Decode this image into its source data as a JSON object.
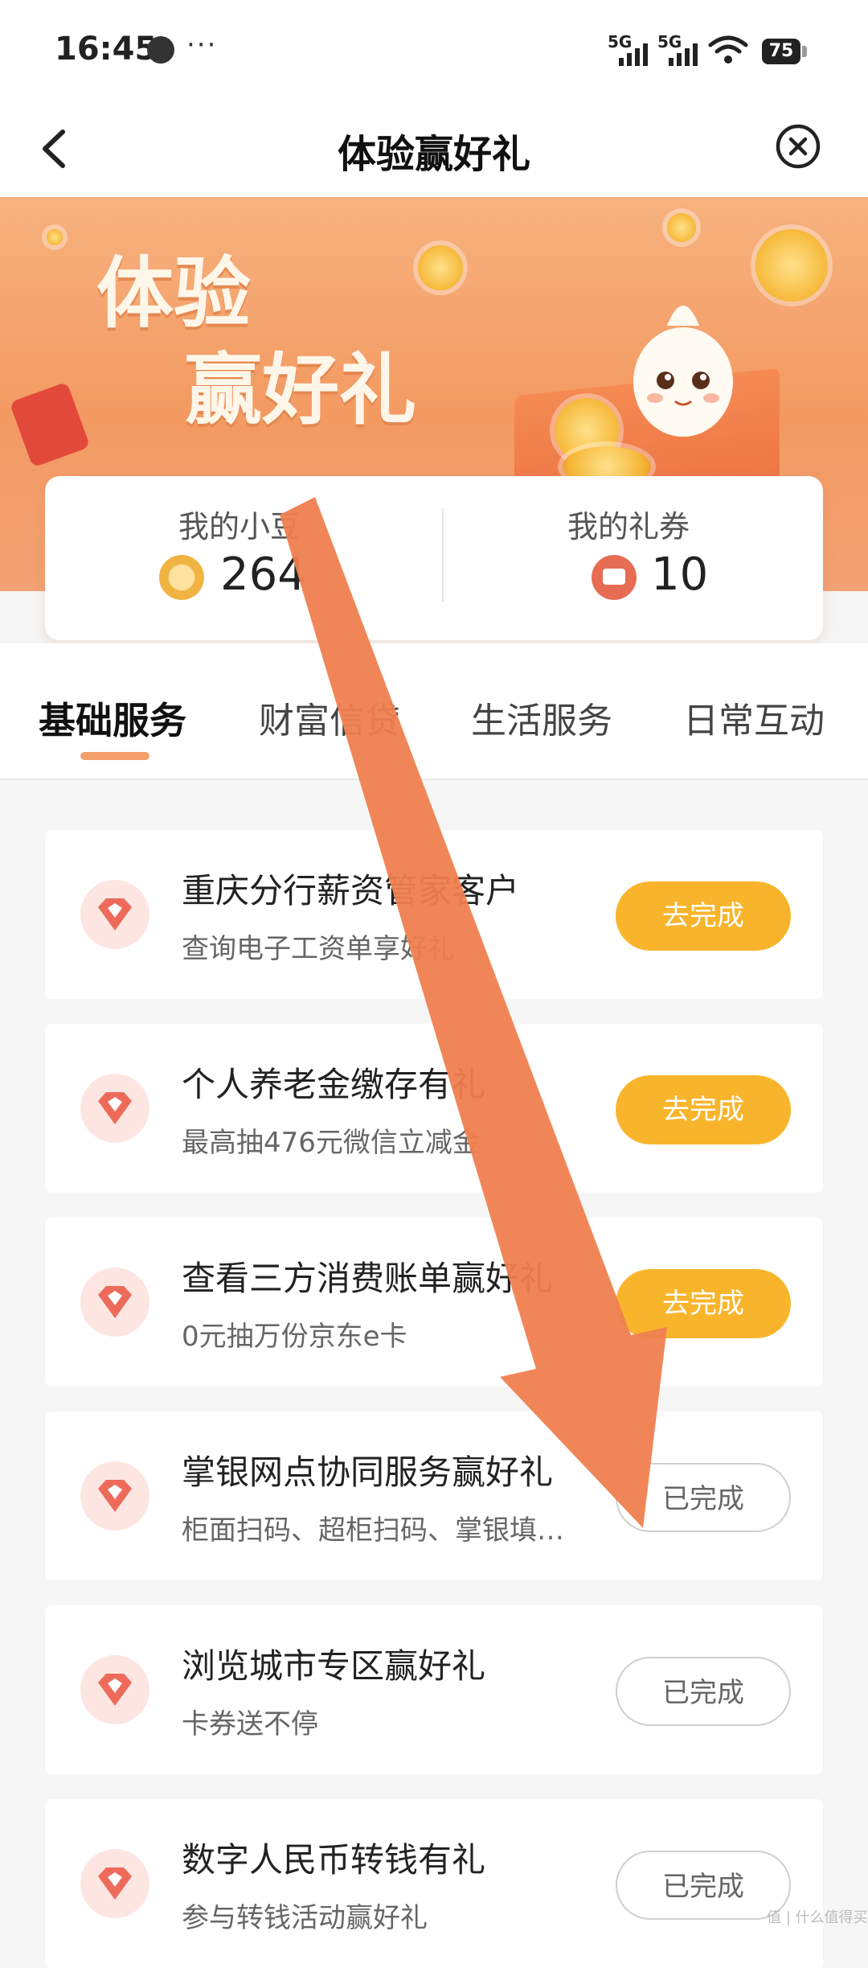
{
  "status_bar": {
    "time": "16:45",
    "more": "···",
    "net1": "5G",
    "net2": "5G",
    "battery": "75"
  },
  "nav": {
    "title": "体验赢好礼"
  },
  "banner": {
    "title_line1": "体验",
    "title_line2": "赢好礼"
  },
  "stats": {
    "beans": {
      "label": "我的小豆",
      "value": "264"
    },
    "coupons": {
      "label": "我的礼券",
      "value": "10"
    }
  },
  "tabs": [
    {
      "label": "基础服务",
      "active": true
    },
    {
      "label": "财富信贷"
    },
    {
      "label": "生活服务"
    },
    {
      "label": "日常互动"
    }
  ],
  "tasks": [
    {
      "title": "重庆分行薪资管家客户",
      "subtitle": "查询电子工资单享好礼",
      "button": "去完成",
      "status": "todo"
    },
    {
      "title": "个人养老金缴存有礼",
      "subtitle": "最高抽476元微信立减金",
      "button": "去完成",
      "status": "todo"
    },
    {
      "title": "查看三方消费账单赢好礼",
      "subtitle": "0元抽万份京东e卡",
      "button": "去完成",
      "status": "todo"
    },
    {
      "title": "掌银网点协同服务赢好礼",
      "subtitle": "柜面扫码、超柜扫码、掌银填…",
      "button": "已完成",
      "status": "done"
    },
    {
      "title": "浏览城市专区赢好礼",
      "subtitle": "卡券送不停",
      "button": "已完成",
      "status": "done"
    },
    {
      "title": "数字人民币转钱有礼",
      "subtitle": "参与转钱活动赢好礼",
      "button": "已完成",
      "status": "done"
    }
  ],
  "watermark": "值 | 什么值得买",
  "colors": {
    "accent": "#f39a62",
    "button_todo": "#f8b52c",
    "arrow": "#ef7f4f"
  }
}
